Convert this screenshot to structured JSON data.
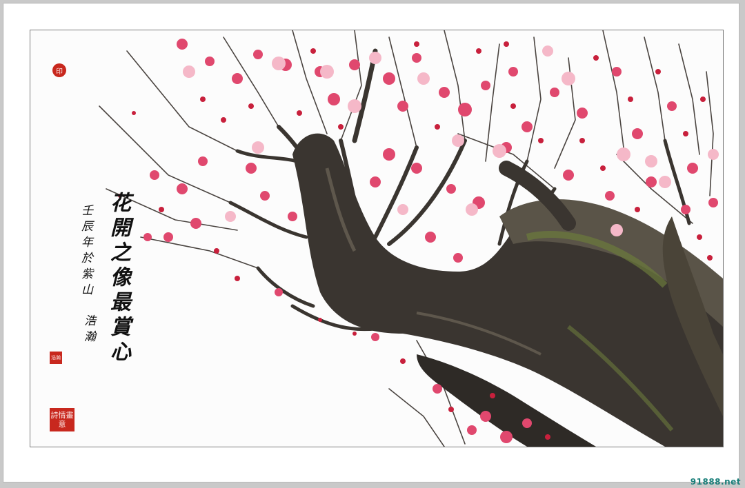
{
  "artwork": {
    "type": "photograph with calligraphy inscription",
    "subject": "plum blossom tree with gnarled trunk",
    "palette": {
      "blossom": "#e0486e",
      "blossom_light": "#f5b8c8",
      "bud": "#c8203c",
      "bark": "#3a3530",
      "moss": "#6b7a3c",
      "seal_red": "#c8281e"
    }
  },
  "inscription": {
    "main_column": "花開之像最賞心",
    "side_column_1": "壬辰年於紫山",
    "side_column_2": "浩瀚"
  },
  "seals": {
    "top": "印",
    "small": "浩瀚",
    "big": "詩情畫意"
  },
  "watermark": "91888.net"
}
